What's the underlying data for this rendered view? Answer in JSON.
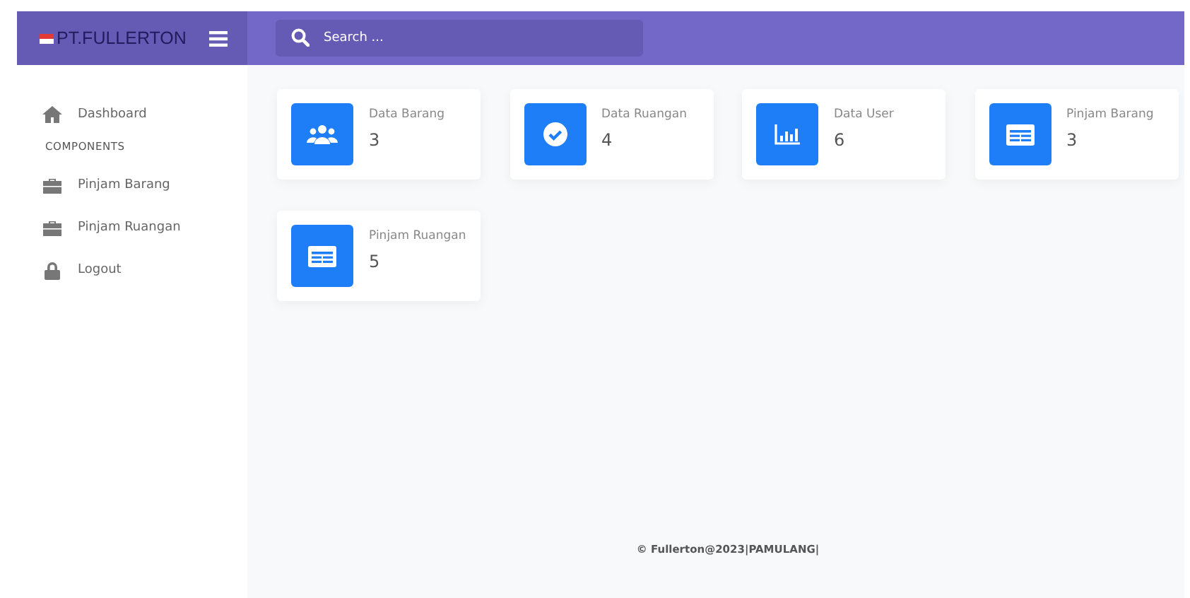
{
  "brand": {
    "name": "PT.FULLERTON"
  },
  "search": {
    "placeholder": "Search ..."
  },
  "sidebar": {
    "items": [
      {
        "label": "Dashboard",
        "kind": "home"
      },
      {
        "heading": "COMPONENTS"
      },
      {
        "label": "Pinjam Barang",
        "kind": "briefcase"
      },
      {
        "label": "Pinjam Ruangan",
        "kind": "briefcase"
      },
      {
        "label": "Logout",
        "kind": "lock"
      }
    ]
  },
  "cards": [
    {
      "label": "Data Barang",
      "value": "3",
      "kind": "users"
    },
    {
      "label": "Data Ruangan",
      "value": "4",
      "kind": "check"
    },
    {
      "label": "Data User",
      "value": "6",
      "kind": "chart"
    },
    {
      "label": "Pinjam Barang",
      "value": "3",
      "kind": "list"
    },
    {
      "label": "Pinjam Ruangan",
      "value": "5",
      "kind": "list"
    }
  ],
  "footer": "© Fullerton@2023|PAMULANG|"
}
